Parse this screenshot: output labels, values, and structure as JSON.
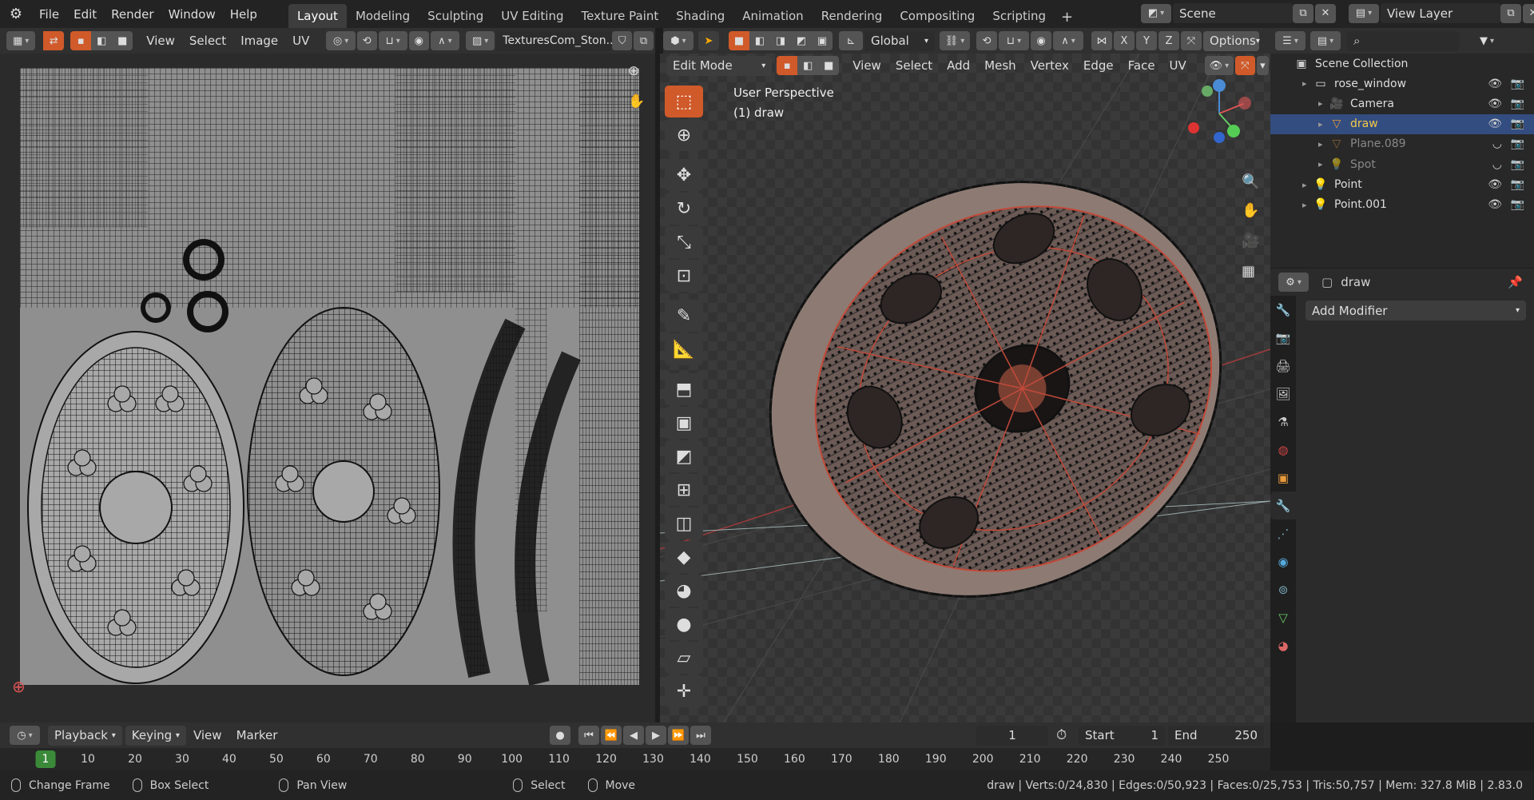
{
  "app": {
    "logo": "blender-icon",
    "menu": [
      "File",
      "Edit",
      "Render",
      "Window",
      "Help"
    ]
  },
  "workspaces": [
    "Layout",
    "Modeling",
    "Sculpting",
    "UV Editing",
    "Texture Paint",
    "Shading",
    "Animation",
    "Rendering",
    "Compositing",
    "Scripting"
  ],
  "active_workspace": "Layout",
  "scene": {
    "label": "Scene",
    "view_layer": "View Layer"
  },
  "uv_editor": {
    "menus": [
      "View",
      "Select",
      "Image",
      "UV"
    ],
    "image_name": "TexturesCom_Ston..."
  },
  "viewport": {
    "mode": "Edit Mode",
    "menus": [
      "View",
      "Select",
      "Add",
      "Mesh",
      "Vertex",
      "Edge",
      "Face",
      "UV"
    ],
    "transform_orientation": "Global",
    "options": "Options",
    "overlay_title": "User Perspective",
    "overlay_object": "(1) draw",
    "axes": {
      "x": "X",
      "y": "Y",
      "z": "Z"
    },
    "tools": [
      {
        "name": "select-box-tool",
        "glyph": "⬚",
        "active": true
      },
      {
        "name": "cursor-tool",
        "glyph": "⊕",
        "active": false
      },
      {
        "name": "move-tool",
        "glyph": "✥",
        "active": false
      },
      {
        "name": "rotate-tool",
        "glyph": "↻",
        "active": false
      },
      {
        "name": "scale-tool",
        "glyph": "⤡",
        "active": false
      },
      {
        "name": "transform-tool",
        "glyph": "⊡",
        "active": false
      },
      {
        "name": "annotate-tool",
        "glyph": "✎",
        "active": false
      },
      {
        "name": "measure-tool",
        "glyph": "📐",
        "active": false
      },
      {
        "name": "extrude-region-tool",
        "glyph": "⬒",
        "active": false
      },
      {
        "name": "inset-faces-tool",
        "glyph": "▣",
        "active": false
      },
      {
        "name": "bevel-tool",
        "glyph": "◩",
        "active": false
      },
      {
        "name": "loop-cut-tool",
        "glyph": "⊞",
        "active": false
      },
      {
        "name": "knife-tool",
        "glyph": "◫",
        "active": false
      },
      {
        "name": "poly-build-tool",
        "glyph": "◆",
        "active": false
      },
      {
        "name": "spin-tool",
        "glyph": "◕",
        "active": false
      },
      {
        "name": "smooth-tool",
        "glyph": "●",
        "active": false
      },
      {
        "name": "edge-slide-tool",
        "glyph": "▱",
        "active": false
      },
      {
        "name": "shrink-fatten-tool",
        "glyph": "✛",
        "active": false
      }
    ]
  },
  "outliner": {
    "root": "Scene Collection",
    "items": [
      {
        "label": "rose_window",
        "icon": "collection-icon",
        "indent": 1,
        "state": "normal"
      },
      {
        "label": "Camera",
        "icon": "camera-icon",
        "indent": 2,
        "state": "normal"
      },
      {
        "label": "draw",
        "icon": "mesh-icon",
        "indent": 2,
        "state": "selected"
      },
      {
        "label": "Plane.089",
        "icon": "mesh-icon",
        "indent": 2,
        "state": "dim"
      },
      {
        "label": "Spot",
        "icon": "light-icon",
        "indent": 2,
        "state": "dim"
      },
      {
        "label": "Point",
        "icon": "light-icon",
        "indent": 1,
        "state": "normal"
      },
      {
        "label": "Point.001",
        "icon": "light-icon",
        "indent": 1,
        "state": "normal"
      }
    ]
  },
  "properties": {
    "object_name": "draw",
    "add_modifier": "Add Modifier"
  },
  "timeline": {
    "menus": [
      "Playback",
      "Keying",
      "View",
      "Marker"
    ],
    "current_frame": "1",
    "start_label": "Start",
    "start": "1",
    "end_label": "End",
    "end": "250",
    "ticks": [
      "1",
      "10",
      "20",
      "30",
      "40",
      "50",
      "60",
      "70",
      "80",
      "90",
      "100",
      "110",
      "120",
      "130",
      "140",
      "150",
      "160",
      "170",
      "180",
      "190",
      "200",
      "210",
      "220",
      "230",
      "240",
      "250"
    ]
  },
  "statusbar": {
    "hints": [
      "Change Frame",
      "Box Select",
      "Pan View",
      "Select",
      "Move"
    ],
    "stats": "draw | Verts:0/24,830 | Edges:0/50,923 | Faces:0/25,753 | Tris:50,757 | Mem: 327.8 MiB | 2.83.0"
  },
  "colors": {
    "accent": "#4772b3",
    "active_tool": "#d05a2a",
    "selected_row": "#334d80"
  }
}
